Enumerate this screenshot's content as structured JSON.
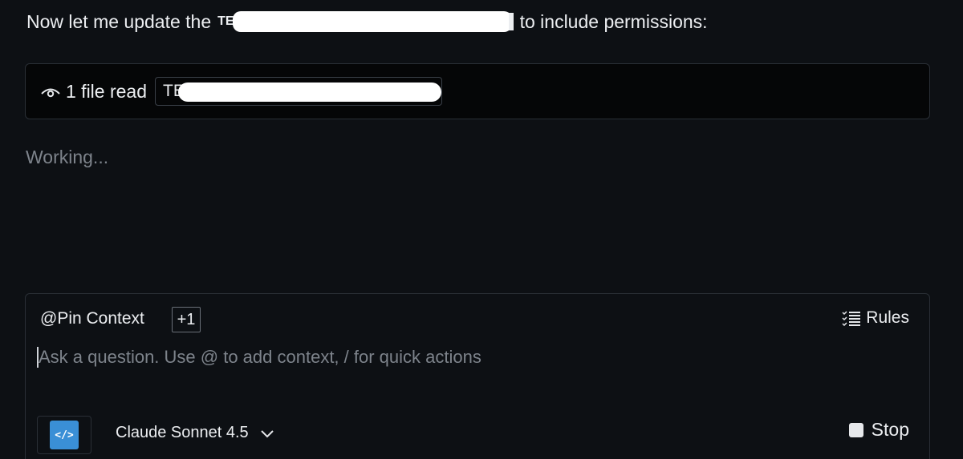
{
  "message": {
    "prefix": "Now let me update the",
    "prefix_tail": "TE",
    "suffix": "to include permissions:"
  },
  "tool_call": {
    "label": "1 file read",
    "file_chip_prefix": "TE",
    "icon": "eye-icon"
  },
  "status": {
    "working": "Working..."
  },
  "composer": {
    "pin_context": "@Pin Context",
    "context_count": "+1",
    "rules_label": "Rules",
    "rules_icon": "list-checks-icon",
    "input_placeholder": "Ask a question. Use @ to add context, / for quick actions",
    "input_value": "",
    "model_icon": "code-icon",
    "model_name": "Claude Sonnet 4.5",
    "stop_label": "Stop"
  },
  "colors": {
    "background": "#0d1014",
    "tool_card_bg": "#050607",
    "border": "#2a2f36",
    "accent_blue": "#3a8fd6",
    "muted_text": "#7d838b"
  }
}
